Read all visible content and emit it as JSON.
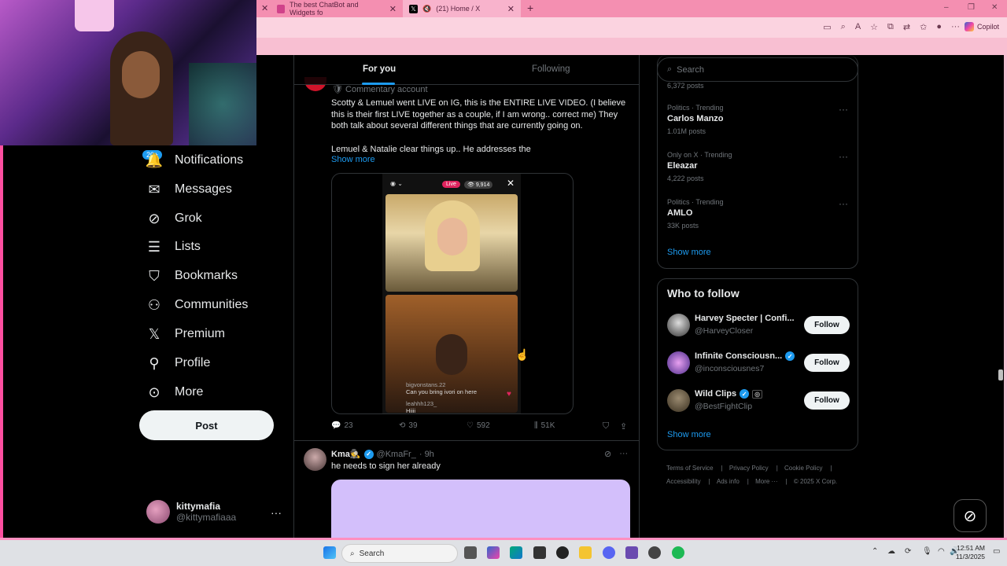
{
  "browser": {
    "tabs": [
      {
        "title": "The best ChatBot and Widgets fo",
        "active": false
      },
      {
        "title": "(21) Home / X",
        "active": true
      }
    ],
    "new_tab": "+",
    "copilot_label": "Copilot",
    "window_controls": [
      "–",
      "❐",
      "✕"
    ]
  },
  "nav": {
    "badge": "20+",
    "items": [
      {
        "label": "Notifications",
        "icon": "bell-icon",
        "glyph": "🔔"
      },
      {
        "label": "Messages",
        "icon": "envelope-icon",
        "glyph": "✉"
      },
      {
        "label": "Grok",
        "icon": "grok-icon",
        "glyph": "⊘"
      },
      {
        "label": "Lists",
        "icon": "list-icon",
        "glyph": "☰"
      },
      {
        "label": "Bookmarks",
        "icon": "bookmark-icon",
        "glyph": "🔖"
      },
      {
        "label": "Communities",
        "icon": "communities-icon",
        "glyph": "👥"
      },
      {
        "label": "Premium",
        "icon": "x-logo-icon",
        "glyph": "𝕏"
      },
      {
        "label": "Profile",
        "icon": "person-icon",
        "glyph": "👤"
      },
      {
        "label": "More",
        "icon": "more-circle-icon",
        "glyph": "⋯"
      }
    ],
    "post_button": "Post",
    "account": {
      "name": "kittymafia",
      "handle": "@kittymafiaaa",
      "more": "···"
    }
  },
  "feed": {
    "tabs": {
      "for_you": "For you",
      "following": "Following"
    },
    "post1": {
      "label": "Commentary account",
      "text_line1": "Scotty & Lemuel went LIVE on IG, this is the ENTIRE LIVE VIDEO. (I believe this is their first LIVE together as a couple, if I am wrong.. correct me) They both talk about several different things that are currently going on.",
      "text_line2": "Lemuel & Natalie clear things up.. He addresses the",
      "show_more": "Show more",
      "media": {
        "live_label": "Live",
        "viewers": "👁 9,914",
        "comment_user1": "bigvonstans.22",
        "comment_text1": "Can you bring ivori on here",
        "comment_user2": "leahhh123_",
        "comment_text2": "Hiiii"
      },
      "replies": "23",
      "reposts": "39",
      "likes": "592",
      "views": "51K"
    },
    "post2": {
      "name": "Kma🕵",
      "handle": "@KmaFr_",
      "time": "· 9h",
      "text": "he needs to sign her already"
    }
  },
  "right": {
    "search_placeholder": "Search",
    "prev_posts": "6,372 posts",
    "trends": [
      {
        "category": "Politics · Trending",
        "name": "Carlos Manzo",
        "posts": "1.01M posts"
      },
      {
        "category": "Only on X · Trending",
        "name": "Eleazar",
        "posts": "4,222 posts"
      },
      {
        "category": "Politics · Trending",
        "name": "AMLO",
        "posts": "33K posts"
      }
    ],
    "trends_show_more": "Show more",
    "who_to_follow_title": "Who to follow",
    "follow": [
      {
        "name": "Harvey Specter | Confi...",
        "handle": "@HarveyCloser",
        "verified": false
      },
      {
        "name": "Infinite Consciousn...",
        "handle": "@inconsciousnes7",
        "verified": true
      },
      {
        "name": "Wild Clips",
        "handle": "@BestFightClip",
        "verified": true
      }
    ],
    "follow_label": "Follow",
    "follow_show_more": "Show more",
    "footer_line1": [
      "Terms of Service",
      "Privacy Policy",
      "Cookie Policy"
    ],
    "footer_line2": [
      "Accessibility",
      "Ads info",
      "More ···",
      "© 2025 X Corp."
    ]
  },
  "taskbar": {
    "search": "Search",
    "time": "12:51 AM",
    "date": "11/3/2025"
  }
}
